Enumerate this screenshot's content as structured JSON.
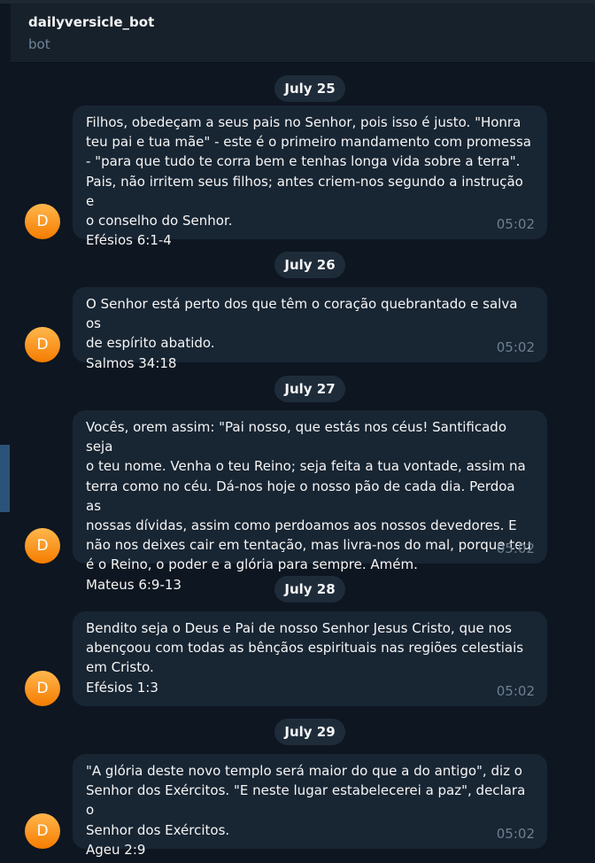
{
  "header": {
    "title": "dailyversicle_bot",
    "status": "bot"
  },
  "messages": [
    {
      "date": "July 25",
      "avatar_letter": "D",
      "text": "Filhos, obedeçam a seus pais no Senhor, pois isso é justo. \"Honra\nteu pai e tua mãe\" - este é o primeiro mandamento com promessa\n- \"para que tudo te corra bem e tenhas longa vida sobre a terra\".\nPais, não irritem seus filhos; antes criem-nos segundo a instrução e\no conselho do Senhor.\nEfésios 6:1-4",
      "time": "05:02"
    },
    {
      "date": "July 26",
      "avatar_letter": "D",
      "text": "O Senhor está perto dos que têm o coração quebrantado e salva os\nde espírito abatido.\nSalmos 34:18",
      "time": "05:02"
    },
    {
      "date": "July 27",
      "avatar_letter": "D",
      "text": "Vocês, orem assim: \"Pai nosso, que estás nos céus! Santificado seja\no teu nome. Venha o teu Reino; seja feita a tua vontade, assim na\nterra como no céu. Dá-nos hoje o nosso pão de cada dia. Perdoa as\nnossas dívidas, assim como perdoamos aos nossos devedores. E\nnão nos deixes cair em tentação, mas livra-nos do mal, porque teu\né o Reino, o poder e a glória para sempre. Amém.\nMateus 6:9-13",
      "time": "05:02"
    },
    {
      "date": "July 28",
      "avatar_letter": "D",
      "text": "Bendito seja o Deus e Pai de nosso Senhor Jesus Cristo, que nos\nabençoou com todas as bênçãos espirituais nas regiões celestiais\nem Cristo.\nEfésios 1:3",
      "time": "05:02"
    },
    {
      "date": "July 29",
      "avatar_letter": "D",
      "text": "\"A glória deste novo templo será maior do que a do antigo\", diz o\nSenhor dos Exércitos. \"E neste lugar estabelecerei a paz\", declara o\nSenhor dos Exércitos.\nAgeu 2:9",
      "time": "05:02"
    }
  ],
  "colors": {
    "background": "#0e1621",
    "header": "#17212b",
    "bubble": "#182533",
    "avatar": "#f59a23",
    "accent": "#2b5278"
  },
  "icons": {
    "avatar": "letter-avatar-icon"
  }
}
